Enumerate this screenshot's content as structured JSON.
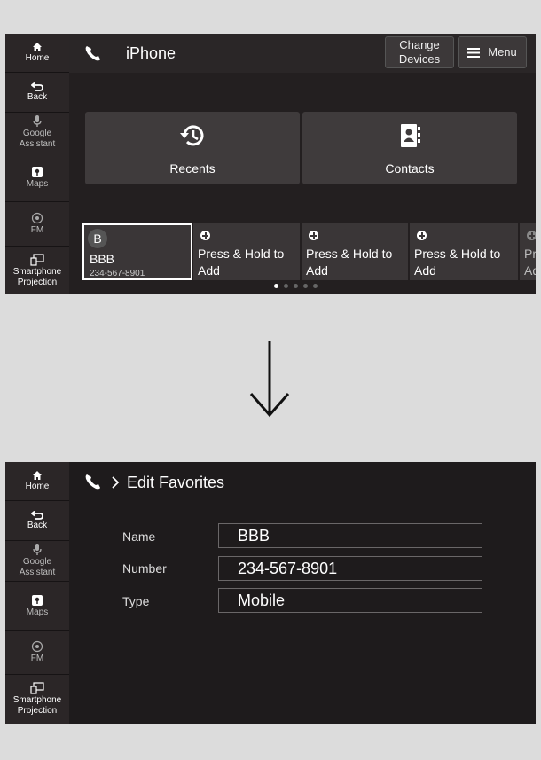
{
  "sidebar": {
    "items": [
      {
        "label": "Home",
        "icon": "home-icon"
      },
      {
        "label": "Back",
        "icon": "back-icon"
      },
      {
        "label": "Google Assistant",
        "icon": "microphone-icon"
      },
      {
        "label": "Maps",
        "icon": "map-pin-icon"
      },
      {
        "label": "FM",
        "icon": "radio-icon"
      },
      {
        "label": "Smartphone Projection",
        "icon": "phone-projection-icon"
      }
    ]
  },
  "screen1": {
    "title": "iPhone",
    "change_devices_label": "Change Devices",
    "menu_label": "Menu",
    "tiles": [
      {
        "label": "Recents",
        "icon": "history-icon"
      },
      {
        "label": "Contacts",
        "icon": "contacts-icon"
      }
    ],
    "favorites": [
      {
        "letter": "B",
        "name": "BBB",
        "number": "234-567-8901"
      },
      {
        "add_text": "Press & Hold to Add"
      },
      {
        "add_text": "Press & Hold to Add"
      },
      {
        "add_text": "Press & Hold to Add"
      },
      {
        "add_text": "Press & Hold to Add"
      }
    ],
    "page_dots": {
      "count": 5,
      "active": 0
    }
  },
  "screen2": {
    "breadcrumb": "Edit Favorites",
    "fields": [
      {
        "label": "Name",
        "value": "BBB"
      },
      {
        "label": "Number",
        "value": "234-567-8901"
      },
      {
        "label": "Type",
        "value": "Mobile"
      }
    ]
  },
  "colors": {
    "screen_bg": "#231f20",
    "tile_bg": "#3f3b3c",
    "page_bg": "#dcdcdc"
  }
}
